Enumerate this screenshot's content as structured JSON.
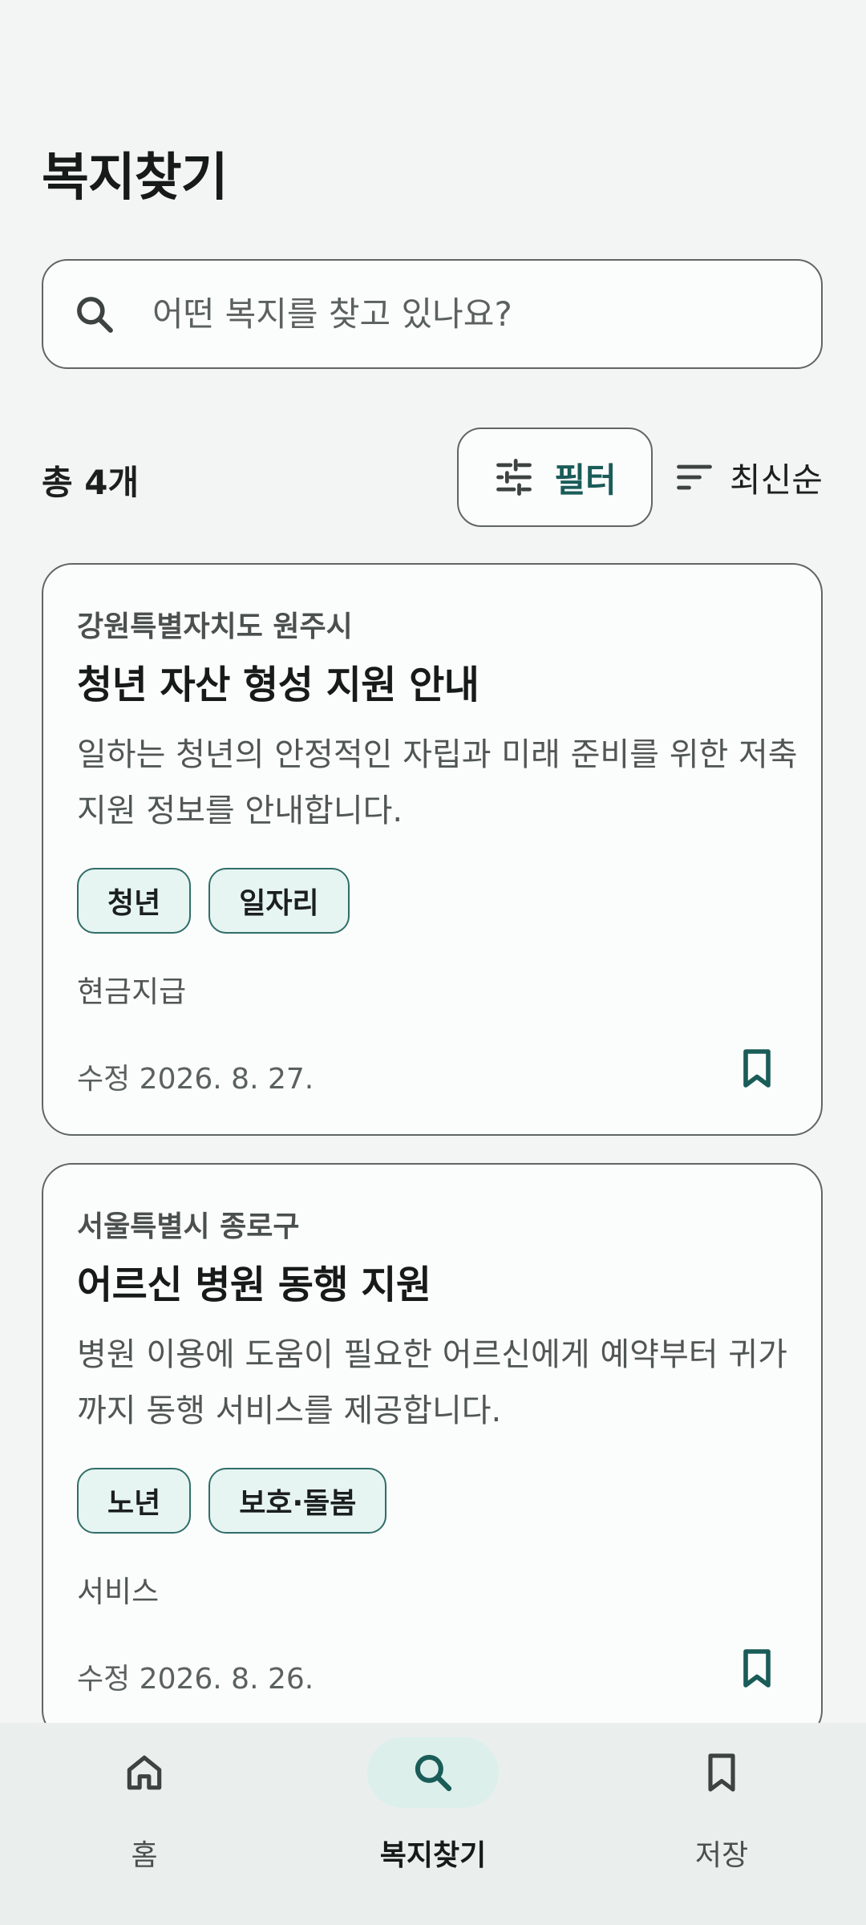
{
  "header": {
    "title": "복지찾기"
  },
  "search": {
    "placeholder": "어떤 복지를 찾고 있나요?",
    "value": ""
  },
  "toolbar": {
    "result_count": "총 4개",
    "filter_label": "필터",
    "sort_label": "최신순"
  },
  "cards": [
    {
      "region": "강원특별자치도 원주시",
      "title": "청년 자산 형성 지원 안내",
      "description": "일하는 청년의 안정적인 자립과 미래 준비를 위한 저축 지원 정보를 안내합니다.",
      "tags": [
        "청년",
        "일자리"
      ],
      "type": "현금지급",
      "modified": "수정 2026. 8. 27."
    },
    {
      "region": "서울특별시 종로구",
      "title": "어르신 병원 동행 지원",
      "description": "병원 이용에 도움이 필요한 어르신에게 예약부터 귀가까지 동행 서비스를 제공합니다.",
      "tags": [
        "노년",
        "보호·돌봄"
      ],
      "type": "서비스",
      "modified": "수정 2026. 8. 26."
    }
  ],
  "bottom_nav": {
    "items": [
      {
        "label": "홈",
        "icon": "home-icon",
        "active": false
      },
      {
        "label": "복지찾기",
        "icon": "search-icon",
        "active": true
      },
      {
        "label": "저장",
        "icon": "bookmark-icon",
        "active": false
      }
    ]
  },
  "colors": {
    "background": "#f3f5f4",
    "accent": "#1a5c58",
    "tag_fill": "#e6f4f2",
    "nav_background": "#eaefed",
    "nav_active_pill": "#dcefeb"
  }
}
